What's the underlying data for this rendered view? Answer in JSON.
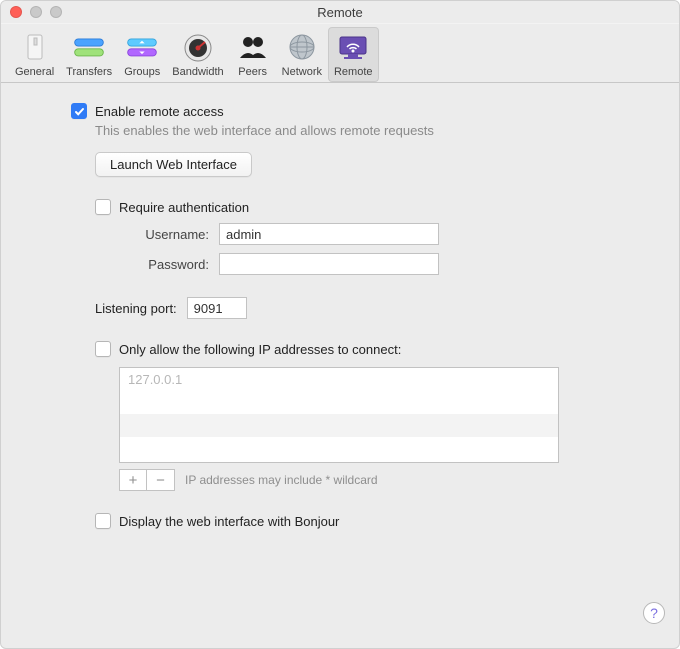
{
  "window": {
    "title": "Remote"
  },
  "toolbar": {
    "items": [
      {
        "label": "General"
      },
      {
        "label": "Transfers"
      },
      {
        "label": "Groups"
      },
      {
        "label": "Bandwidth"
      },
      {
        "label": "Peers"
      },
      {
        "label": "Network"
      },
      {
        "label": "Remote",
        "selected": true
      }
    ]
  },
  "remote": {
    "enable_label": "Enable remote access",
    "enable_desc": "This enables the web interface and allows remote requests",
    "enable_checked": true,
    "launch_button": "Launch Web Interface",
    "auth_label": "Require authentication",
    "auth_checked": false,
    "username_label": "Username:",
    "username_value": "admin",
    "password_label": "Password:",
    "password_value": "",
    "port_label": "Listening port:",
    "port_value": "9091",
    "ipallow_label": "Only allow the following IP addresses to connect:",
    "ipallow_checked": false,
    "ip_list_placeholder": "127.0.0.1",
    "add_label": "+",
    "remove_label": "−",
    "wildcard_hint": "IP addresses may include * wildcard",
    "bonjour_label": "Display the web interface with Bonjour",
    "bonjour_checked": false
  },
  "help_glyph": "?"
}
